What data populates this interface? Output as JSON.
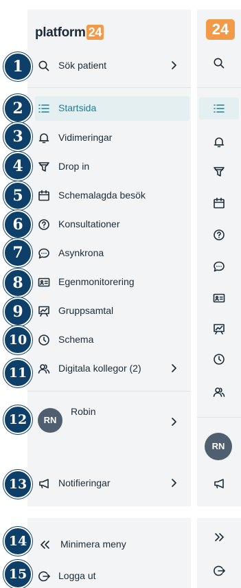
{
  "brand": {
    "logo_text": "platform",
    "logo_badge": "24"
  },
  "expanded_menu": {
    "search": {
      "label": "Sök patient"
    },
    "items": [
      {
        "label": "Startsida"
      },
      {
        "label": "Vidimeringar"
      },
      {
        "label": "Drop in"
      },
      {
        "label": "Schemalagda besök"
      },
      {
        "label": "Konsultationer"
      },
      {
        "label": "Asynkrona"
      },
      {
        "label": "Egenmonitorering"
      },
      {
        "label": "Gruppsamtal"
      },
      {
        "label": "Schema"
      },
      {
        "label": "Digitala kollegor (2)"
      }
    ],
    "active_item": "Startsida",
    "user": {
      "initials": "RN",
      "name": "Robin"
    },
    "notifications": {
      "label": "Notifieringar"
    },
    "footer": {
      "minimize_label": "Minimera meny",
      "logout_label": "Logga ut"
    }
  },
  "collapsed_menu": {
    "avatar_initials": "RN"
  },
  "annotation_badges": [
    "1",
    "2",
    "3",
    "4",
    "5",
    "6",
    "7",
    "8",
    "9",
    "10",
    "11",
    "12",
    "13",
    "14",
    "15"
  ],
  "colors": {
    "panel": "#f3f4f5",
    "active_bg": "#e3eff1",
    "active_text": "#1a7f98",
    "badge": "#0d3f68",
    "logo_badge": "#f39a48",
    "avatar": "#4f5f6f"
  },
  "icons": [
    "search-icon",
    "list-icon",
    "bell-icon",
    "funnel-icon",
    "calendar-icon",
    "question-icon",
    "chat-icon",
    "id-card-icon",
    "presentation-icon",
    "clock-icon",
    "people-icon",
    "megaphone-icon",
    "double-chevron-left-icon",
    "logout-icon",
    "chevron-right-icon"
  ]
}
